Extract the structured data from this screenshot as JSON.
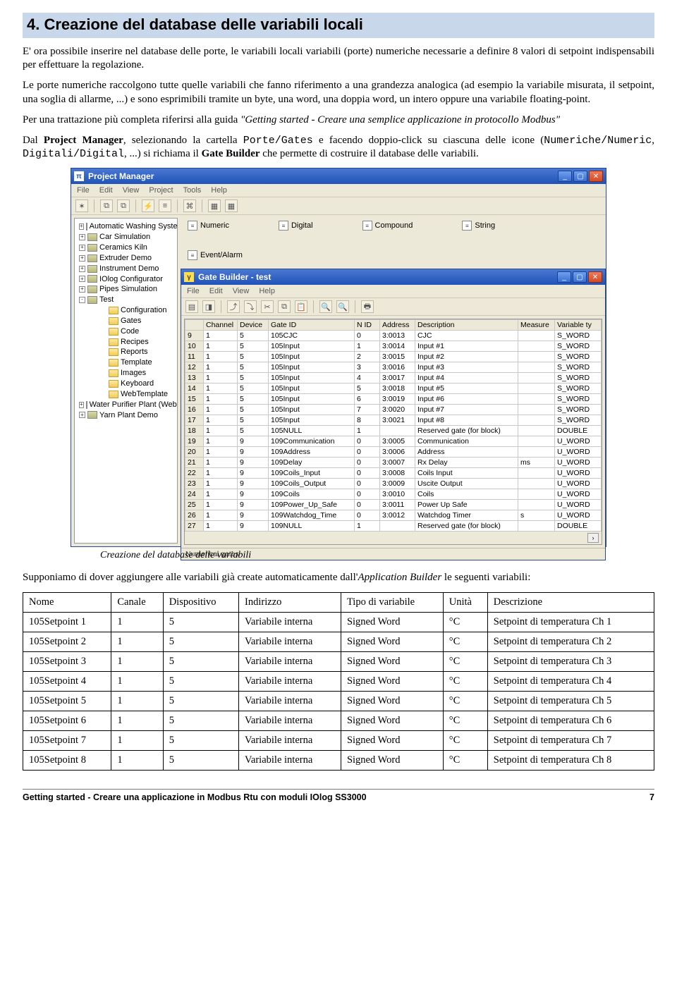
{
  "section_title": "4. Creazione del database delle variabili locali",
  "para1": "E' ora possibile inserire nel database delle porte, le variabili locali variabili (porte) numeriche necessarie a definire 8 valori di setpoint indispensabili per effettuare la regolazione.",
  "para2": "Le porte numeriche raccolgono tutte quelle variabili che fanno riferimento a una grandezza analogica (ad esempio la variabile misurata, il setpoint, una soglia di allarme, ...) e sono esprimibili tramite un byte, una word, una doppia word, un intero oppure una variabile floating-point.",
  "para3_a": "Per una trattazione più completa riferirsi alla guida ",
  "para3_ital": "\"Getting started - Creare una semplice applicazione in protocollo Modbus\"",
  "para4_a": "Dal ",
  "para4_b": "Project Manager",
  "para4_c": ", selezionando la cartella ",
  "para4_mono1": "Porte/Gates",
  "para4_d": " e facendo doppio-click su ciascuna delle icone (",
  "para4_mono2": "Numeriche/Numeric",
  "para4_e": ", ",
  "para4_mono3": "Digitali/Digital",
  "para4_f": ", ...) si richiama il ",
  "para4_b2": "Gate Builder",
  "para4_g": " che permette di costruire il database delle variabili.",
  "pm": {
    "title": "Project Manager",
    "menu": [
      "File",
      "Edit",
      "View",
      "Project",
      "Tools",
      "Help"
    ],
    "tree": [
      {
        "lvl": 1,
        "sq": "+",
        "icon": "db",
        "label": "Automatic Washing System Demo"
      },
      {
        "lvl": 1,
        "sq": "+",
        "icon": "db",
        "label": "Car Simulation"
      },
      {
        "lvl": 1,
        "sq": "+",
        "icon": "db",
        "label": "Ceramics Kiln"
      },
      {
        "lvl": 1,
        "sq": "+",
        "icon": "db",
        "label": "Extruder Demo"
      },
      {
        "lvl": 1,
        "sq": "+",
        "icon": "db",
        "label": "Instrument Demo"
      },
      {
        "lvl": 1,
        "sq": "+",
        "icon": "db",
        "label": "IOlog Configurator"
      },
      {
        "lvl": 1,
        "sq": "+",
        "icon": "db",
        "label": "Pipes Simulation"
      },
      {
        "lvl": 1,
        "sq": "-",
        "icon": "db",
        "label": "Test"
      },
      {
        "lvl": 2,
        "sq": "",
        "icon": "folder",
        "label": "Configuration"
      },
      {
        "lvl": 2,
        "sq": "",
        "icon": "folder",
        "label": "Gates"
      },
      {
        "lvl": 2,
        "sq": "",
        "icon": "folder",
        "label": "Code"
      },
      {
        "lvl": 2,
        "sq": "",
        "icon": "folder",
        "label": "Recipes"
      },
      {
        "lvl": 2,
        "sq": "",
        "icon": "folder",
        "label": "Reports"
      },
      {
        "lvl": 2,
        "sq": "",
        "icon": "folder",
        "label": "Template"
      },
      {
        "lvl": 2,
        "sq": "",
        "icon": "folder",
        "label": "Images"
      },
      {
        "lvl": 2,
        "sq": "",
        "icon": "folder",
        "label": "Keyboard"
      },
      {
        "lvl": 2,
        "sq": "",
        "icon": "folder",
        "label": "WebTemplate"
      },
      {
        "lvl": 1,
        "sq": "+",
        "icon": "db",
        "label": "Water Purifier Plant (Web Server)"
      },
      {
        "lvl": 1,
        "sq": "+",
        "icon": "db",
        "label": "Yarn Plant Demo"
      }
    ],
    "gate_icons": [
      "Numeric",
      "Digital",
      "Compound",
      "String",
      "Event/Alarm"
    ]
  },
  "gb": {
    "title": "Gate Builder - test",
    "menu": [
      "File",
      "Edit",
      "View",
      "Help"
    ],
    "cols": [
      "",
      "Channel",
      "Device",
      "Gate ID",
      "N ID",
      "Address",
      "Description",
      "Measure",
      "Variable ty"
    ],
    "widths": [
      "26px",
      "48px",
      "44px",
      "122px",
      "36px",
      "50px",
      "146px",
      "52px",
      "66px"
    ],
    "rows": [
      [
        "9",
        "1",
        "5",
        "105CJC",
        "0",
        "3:0013",
        "CJC",
        "",
        "S_WORD"
      ],
      [
        "10",
        "1",
        "5",
        "105Input",
        "1",
        "3:0014",
        "Input #1",
        "",
        "S_WORD"
      ],
      [
        "11",
        "1",
        "5",
        "105Input",
        "2",
        "3:0015",
        "Input #2",
        "",
        "S_WORD"
      ],
      [
        "12",
        "1",
        "5",
        "105Input",
        "3",
        "3:0016",
        "Input #3",
        "",
        "S_WORD"
      ],
      [
        "13",
        "1",
        "5",
        "105Input",
        "4",
        "3:0017",
        "Input #4",
        "",
        "S_WORD"
      ],
      [
        "14",
        "1",
        "5",
        "105Input",
        "5",
        "3:0018",
        "Input #5",
        "",
        "S_WORD"
      ],
      [
        "15",
        "1",
        "5",
        "105Input",
        "6",
        "3:0019",
        "Input #6",
        "",
        "S_WORD"
      ],
      [
        "16",
        "1",
        "5",
        "105Input",
        "7",
        "3:0020",
        "Input #7",
        "",
        "S_WORD"
      ],
      [
        "17",
        "1",
        "5",
        "105Input",
        "8",
        "3:0021",
        "Input #8",
        "",
        "S_WORD"
      ],
      [
        "18",
        "1",
        "5",
        "105NULL",
        "1",
        "",
        "Reserved gate (for block)",
        "",
        "DOUBLE"
      ],
      [
        "19",
        "1",
        "9",
        "109Communication",
        "0",
        "3:0005",
        "Communication",
        "",
        "U_WORD"
      ],
      [
        "20",
        "1",
        "9",
        "109Address",
        "0",
        "3:0006",
        "Address",
        "",
        "U_WORD"
      ],
      [
        "21",
        "1",
        "9",
        "109Delay",
        "0",
        "3:0007",
        "Rx Delay",
        "ms",
        "U_WORD"
      ],
      [
        "22",
        "1",
        "9",
        "109Coils_Input",
        "0",
        "3:0008",
        "Coils Input",
        "",
        "U_WORD"
      ],
      [
        "23",
        "1",
        "9",
        "109Coils_Output",
        "0",
        "3:0009",
        "Uscite Output",
        "",
        "U_WORD"
      ],
      [
        "24",
        "1",
        "9",
        "109Coils",
        "0",
        "3:0010",
        "Coils",
        "",
        "U_WORD"
      ],
      [
        "25",
        "1",
        "9",
        "109Power_Up_Safe",
        "0",
        "3:0011",
        "Power Up Safe",
        "",
        "U_WORD"
      ],
      [
        "26",
        "1",
        "9",
        "109Watchdog_Time",
        "0",
        "3:0012",
        "Watchdog Timer",
        "s",
        "U_WORD"
      ],
      [
        "27",
        "1",
        "9",
        "109NULL",
        "1",
        "",
        "Reserved gate (for block)",
        "",
        "DOUBLE"
      ]
    ],
    "status": "Numerical gates"
  },
  "caption": "Creazione del database delle variabili",
  "para5_a": "Supponiamo di dover aggiungere alle variabili già create automaticamente dall'",
  "para5_ital": "Application Builder",
  "para5_b": " le seguenti variabili:",
  "vars_cols": [
    "Nome",
    "Canale",
    "Dispositivo",
    "Indirizzo",
    "Tipo di variabile",
    "Unità",
    "Descrizione"
  ],
  "vars_rows": [
    [
      "105Setpoint 1",
      "1",
      "5",
      "Variabile interna",
      "Signed Word",
      "°C",
      "Setpoint di temperatura Ch 1"
    ],
    [
      "105Setpoint 2",
      "1",
      "5",
      "Variabile interna",
      "Signed Word",
      "°C",
      "Setpoint di temperatura Ch 2"
    ],
    [
      "105Setpoint 3",
      "1",
      "5",
      "Variabile interna",
      "Signed Word",
      "°C",
      "Setpoint di temperatura Ch 3"
    ],
    [
      "105Setpoint 4",
      "1",
      "5",
      "Variabile interna",
      "Signed Word",
      "°C",
      "Setpoint di temperatura Ch 4"
    ],
    [
      "105Setpoint 5",
      "1",
      "5",
      "Variabile interna",
      "Signed Word",
      "°C",
      "Setpoint di temperatura Ch 5"
    ],
    [
      "105Setpoint 6",
      "1",
      "5",
      "Variabile interna",
      "Signed Word",
      "°C",
      "Setpoint di temperatura Ch 6"
    ],
    [
      "105Setpoint 7",
      "1",
      "5",
      "Variabile interna",
      "Signed Word",
      "°C",
      "Setpoint di temperatura Ch 7"
    ],
    [
      "105Setpoint 8",
      "1",
      "5",
      "Variabile interna",
      "Signed Word",
      "°C",
      "Setpoint di temperatura Ch 8"
    ]
  ],
  "footer_left": "Getting started - Creare una applicazione in Modbus Rtu con moduli IOlog SS3000",
  "footer_right": "7"
}
